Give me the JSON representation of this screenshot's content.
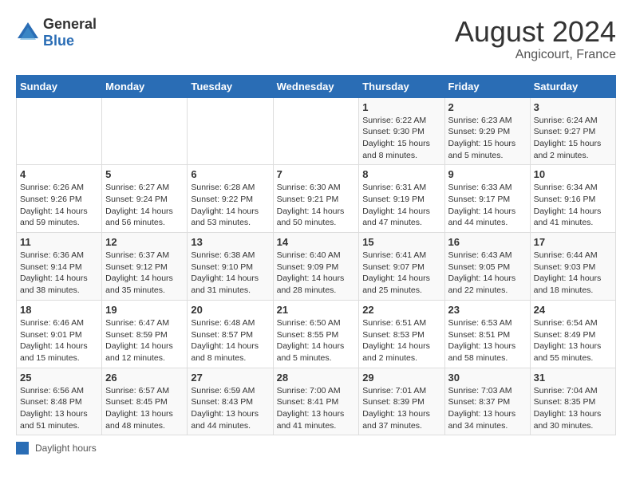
{
  "logo": {
    "general": "General",
    "blue": "Blue"
  },
  "title": "August 2024",
  "subtitle": "Angicourt, France",
  "days_header": [
    "Sunday",
    "Monday",
    "Tuesday",
    "Wednesday",
    "Thursday",
    "Friday",
    "Saturday"
  ],
  "weeks": [
    [
      {
        "day": "",
        "info": ""
      },
      {
        "day": "",
        "info": ""
      },
      {
        "day": "",
        "info": ""
      },
      {
        "day": "",
        "info": ""
      },
      {
        "day": "1",
        "info": "Sunrise: 6:22 AM\nSunset: 9:30 PM\nDaylight: 15 hours\nand 8 minutes."
      },
      {
        "day": "2",
        "info": "Sunrise: 6:23 AM\nSunset: 9:29 PM\nDaylight: 15 hours\nand 5 minutes."
      },
      {
        "day": "3",
        "info": "Sunrise: 6:24 AM\nSunset: 9:27 PM\nDaylight: 15 hours\nand 2 minutes."
      }
    ],
    [
      {
        "day": "4",
        "info": "Sunrise: 6:26 AM\nSunset: 9:26 PM\nDaylight: 14 hours\nand 59 minutes."
      },
      {
        "day": "5",
        "info": "Sunrise: 6:27 AM\nSunset: 9:24 PM\nDaylight: 14 hours\nand 56 minutes."
      },
      {
        "day": "6",
        "info": "Sunrise: 6:28 AM\nSunset: 9:22 PM\nDaylight: 14 hours\nand 53 minutes."
      },
      {
        "day": "7",
        "info": "Sunrise: 6:30 AM\nSunset: 9:21 PM\nDaylight: 14 hours\nand 50 minutes."
      },
      {
        "day": "8",
        "info": "Sunrise: 6:31 AM\nSunset: 9:19 PM\nDaylight: 14 hours\nand 47 minutes."
      },
      {
        "day": "9",
        "info": "Sunrise: 6:33 AM\nSunset: 9:17 PM\nDaylight: 14 hours\nand 44 minutes."
      },
      {
        "day": "10",
        "info": "Sunrise: 6:34 AM\nSunset: 9:16 PM\nDaylight: 14 hours\nand 41 minutes."
      }
    ],
    [
      {
        "day": "11",
        "info": "Sunrise: 6:36 AM\nSunset: 9:14 PM\nDaylight: 14 hours\nand 38 minutes."
      },
      {
        "day": "12",
        "info": "Sunrise: 6:37 AM\nSunset: 9:12 PM\nDaylight: 14 hours\nand 35 minutes."
      },
      {
        "day": "13",
        "info": "Sunrise: 6:38 AM\nSunset: 9:10 PM\nDaylight: 14 hours\nand 31 minutes."
      },
      {
        "day": "14",
        "info": "Sunrise: 6:40 AM\nSunset: 9:09 PM\nDaylight: 14 hours\nand 28 minutes."
      },
      {
        "day": "15",
        "info": "Sunrise: 6:41 AM\nSunset: 9:07 PM\nDaylight: 14 hours\nand 25 minutes."
      },
      {
        "day": "16",
        "info": "Sunrise: 6:43 AM\nSunset: 9:05 PM\nDaylight: 14 hours\nand 22 minutes."
      },
      {
        "day": "17",
        "info": "Sunrise: 6:44 AM\nSunset: 9:03 PM\nDaylight: 14 hours\nand 18 minutes."
      }
    ],
    [
      {
        "day": "18",
        "info": "Sunrise: 6:46 AM\nSunset: 9:01 PM\nDaylight: 14 hours\nand 15 minutes."
      },
      {
        "day": "19",
        "info": "Sunrise: 6:47 AM\nSunset: 8:59 PM\nDaylight: 14 hours\nand 12 minutes."
      },
      {
        "day": "20",
        "info": "Sunrise: 6:48 AM\nSunset: 8:57 PM\nDaylight: 14 hours\nand 8 minutes."
      },
      {
        "day": "21",
        "info": "Sunrise: 6:50 AM\nSunset: 8:55 PM\nDaylight: 14 hours\nand 5 minutes."
      },
      {
        "day": "22",
        "info": "Sunrise: 6:51 AM\nSunset: 8:53 PM\nDaylight: 14 hours\nand 2 minutes."
      },
      {
        "day": "23",
        "info": "Sunrise: 6:53 AM\nSunset: 8:51 PM\nDaylight: 13 hours\nand 58 minutes."
      },
      {
        "day": "24",
        "info": "Sunrise: 6:54 AM\nSunset: 8:49 PM\nDaylight: 13 hours\nand 55 minutes."
      }
    ],
    [
      {
        "day": "25",
        "info": "Sunrise: 6:56 AM\nSunset: 8:48 PM\nDaylight: 13 hours\nand 51 minutes."
      },
      {
        "day": "26",
        "info": "Sunrise: 6:57 AM\nSunset: 8:45 PM\nDaylight: 13 hours\nand 48 minutes."
      },
      {
        "day": "27",
        "info": "Sunrise: 6:59 AM\nSunset: 8:43 PM\nDaylight: 13 hours\nand 44 minutes."
      },
      {
        "day": "28",
        "info": "Sunrise: 7:00 AM\nSunset: 8:41 PM\nDaylight: 13 hours\nand 41 minutes."
      },
      {
        "day": "29",
        "info": "Sunrise: 7:01 AM\nSunset: 8:39 PM\nDaylight: 13 hours\nand 37 minutes."
      },
      {
        "day": "30",
        "info": "Sunrise: 7:03 AM\nSunset: 8:37 PM\nDaylight: 13 hours\nand 34 minutes."
      },
      {
        "day": "31",
        "info": "Sunrise: 7:04 AM\nSunset: 8:35 PM\nDaylight: 13 hours\nand 30 minutes."
      }
    ]
  ],
  "footer": {
    "legend_label": "Daylight hours"
  }
}
